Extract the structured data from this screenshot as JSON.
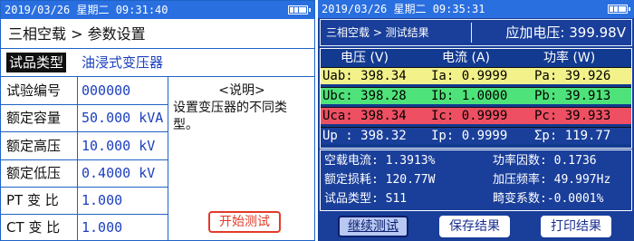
{
  "left": {
    "status": {
      "datetime": "2019/03/26 星期二 09:31:40",
      "battery_icon": "battery-full-icon"
    },
    "breadcrumb": "三相空载 > 参数设置",
    "sample_type_label": "试品类型",
    "sample_type_value": "油浸式变压器",
    "fields": [
      {
        "label": "试验编号",
        "value": "000000"
      },
      {
        "label": "额定容量",
        "value": "50.000 kVA"
      },
      {
        "label": "额定高压",
        "value": "10.000 kV"
      },
      {
        "label": "额定低压",
        "value": "0.4000 kV"
      },
      {
        "label": "PT 变 比",
        "value": "1.000"
      },
      {
        "label": "CT 变 比",
        "value": "1.000"
      }
    ],
    "description": {
      "title": "<说明>",
      "body": "设置变压器的不同类型。"
    },
    "start_button": "开始测试"
  },
  "right": {
    "status": {
      "datetime": "2019/03/26 星期二 09:35:31",
      "battery_icon": "battery-full-icon"
    },
    "breadcrumb": "三相空载 > 测试结果",
    "applied_voltage": "应加电压: 399.98V",
    "table": {
      "headers": [
        "电压 (V)",
        "电流 (A)",
        "功率 (W)"
      ],
      "rows": [
        {
          "name": "a",
          "color": "#f3f28a",
          "voltage": "Uab: 398.34",
          "current": "Ia: 0.9999",
          "power": "Pa: 39.926"
        },
        {
          "name": "b",
          "color": "#4ee37a",
          "voltage": "Ubc: 398.28",
          "current": "Ib: 1.0000",
          "power": "Pb: 39.913"
        },
        {
          "name": "c",
          "color": "#ee4f63",
          "voltage": "Uca: 398.34",
          "current": "Ic: 0.9999",
          "power": "Pc: 39.933"
        },
        {
          "name": "sum",
          "color": "#1a3f9a",
          "voltage": "Up : 398.32",
          "current": "Ip: 0.9999",
          "power": "Σp: 119.77"
        }
      ]
    },
    "info": {
      "no_load_current": "空载电流: 1.3913%",
      "power_factor": "功率因数: 0.1736",
      "rated_loss": "额定损耗: 120.77W",
      "freq": "加压频率: 49.997Hz",
      "sample_type": "试品类型: S11",
      "distortion": "畸变系数:-0.0001%"
    },
    "buttons": [
      "继续测试",
      "保存结果",
      "打印结果"
    ]
  }
}
